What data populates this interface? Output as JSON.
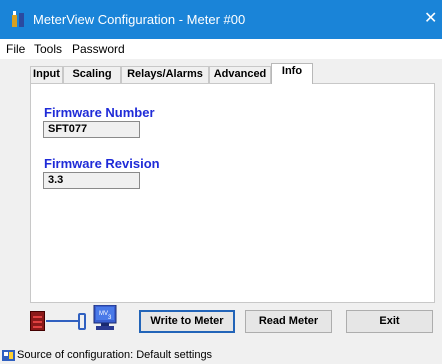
{
  "window": {
    "title": "MeterView Configuration - Meter #00",
    "close": "✕"
  },
  "menu": {
    "items": [
      "File",
      "Tools",
      "Password"
    ]
  },
  "tabs": [
    "Input",
    "Scaling",
    "Relays/Alarms",
    "Advanced",
    "Info"
  ],
  "active_tab": "Info",
  "info": {
    "firmware_number_label": "Firmware Number",
    "firmware_number_value": "SFT077",
    "firmware_revision_label": "Firmware Revision",
    "firmware_revision_value": "3.3"
  },
  "buttons": {
    "write": "Write to Meter",
    "read": "Read Meter",
    "exit": "Exit"
  },
  "status": {
    "text": "Source of configuration: Default settings"
  },
  "colors": {
    "titlebar": "#1a84d8",
    "label_blue": "#1f2bd8"
  }
}
